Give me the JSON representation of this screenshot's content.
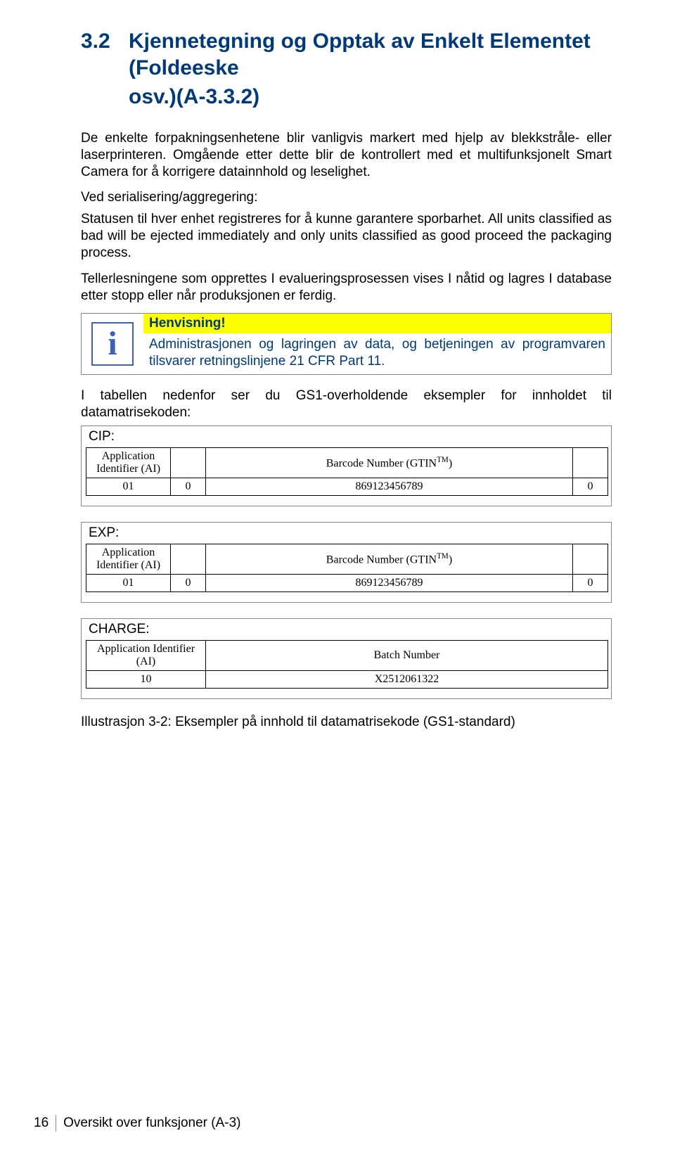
{
  "heading": {
    "number": "3.2",
    "line1": "Kjennetegning og Opptak av Enkelt Elementet (Foldeeske",
    "line2": "osv.)(A-3.3.2)"
  },
  "paragraphs": {
    "p1": "De enkelte forpakningsenhetene blir vanligvis markert med hjelp av blekkstråle- eller laserprinteren. Omgående etter dette blir de kontrollert med et multifunksjonelt Smart Camera for å korrigere datainnhold og leselighet.",
    "p2": "Ved serialisering/aggregering:",
    "p3": "Statusen til hver enhet registreres for å kunne garantere sporbarhet. All units classified as bad will be ejected immediately and only units classified as good proceed the packaging process.",
    "p4": "Tellerlesningene som opprettes I evalueringsprosessen vises I nåtid og lagres I database etter stopp eller når produksjonen er ferdig."
  },
  "note": {
    "icon_char": "i",
    "title": "Henvisning!",
    "text": "Administrasjonen og lagringen av data, og betjeningen av programvaren tilsvarer retningslinjene 21 CFR Part 11."
  },
  "table_intro": "I tabellen nedenfor ser du GS1-overholdende eksempler for innholdet til datamatrisekoden:",
  "examples": {
    "cip": {
      "label": "CIP:",
      "headers": [
        "Application Identifier (AI)",
        "",
        "Barcode Number (GTIN™)",
        ""
      ],
      "row": [
        "01",
        "0",
        "869123456789",
        "0"
      ]
    },
    "exp": {
      "label": "EXP:",
      "headers": [
        "Application Identifier (AI)",
        "",
        "Barcode Number (GTIN™)",
        ""
      ],
      "row": [
        "01",
        "0",
        "869123456789",
        "0"
      ]
    },
    "charge": {
      "label": "CHARGE:",
      "headers": [
        "Application Identifier (AI)",
        "Batch Number"
      ],
      "row": [
        "10",
        "X2512061322"
      ]
    }
  },
  "caption": "Illustrasjon 3-2: Eksempler på innhold til datamatrisekode (GS1-standard)",
  "footer": {
    "page_number": "16",
    "section": "Oversikt over funksjoner (A-3)"
  }
}
